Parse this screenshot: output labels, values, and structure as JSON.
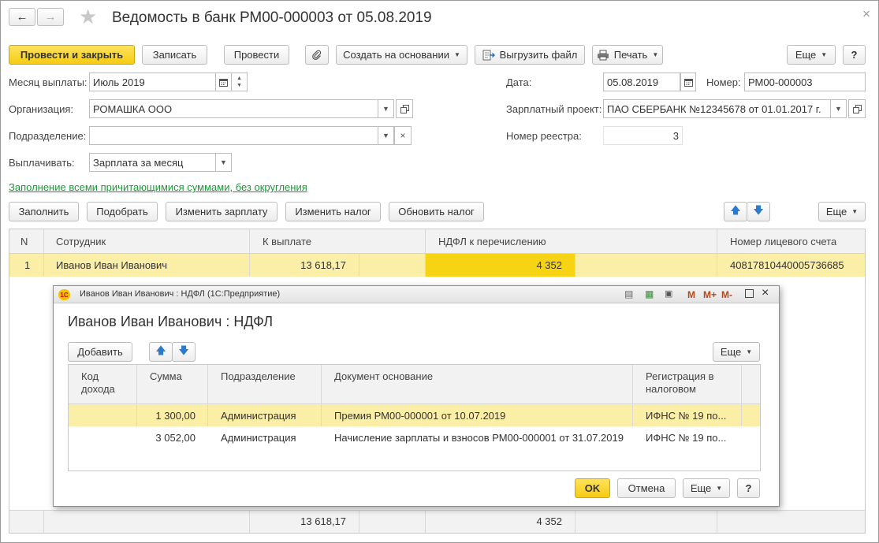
{
  "window": {
    "title": "Ведомость в банк РМ00-000003 от 05.08.2019",
    "close": "×"
  },
  "toolbar": {
    "post_close": "Провести и закрыть",
    "save": "Записать",
    "post": "Провести",
    "create_based": "Создать на основании",
    "export_file": "Выгрузить файл",
    "print": "Печать",
    "more": "Еще",
    "help": "?"
  },
  "form": {
    "month_label": "Месяц выплаты:",
    "month_value": "Июль 2019",
    "org_label": "Организация:",
    "org_value": "РОМАШКА ООО",
    "dept_label": "Подразделение:",
    "dept_value": "",
    "pay_label": "Выплачивать:",
    "pay_value": "Зарплата за месяц",
    "date_label": "Дата:",
    "date_value": "05.08.2019",
    "number_label": "Номер:",
    "number_value": "РМ00-000003",
    "project_label": "Зарплатный проект:",
    "project_value": "ПАО СБЕРБАНК №12345678 от 01.01.2017 г.",
    "registry_label": "Номер реестра:",
    "registry_value": "3",
    "fill_link": "Заполнение всеми причитающимися суммами, без округления"
  },
  "table_toolbar": {
    "fill": "Заполнить",
    "pick": "Подобрать",
    "change_salary": "Изменить зарплату",
    "change_tax": "Изменить налог",
    "update_tax": "Обновить налог",
    "more": "Еще"
  },
  "table": {
    "headers": {
      "n": "N",
      "employee": "Сотрудник",
      "to_pay": "К выплате",
      "ndfl": "НДФЛ к перечислению",
      "account": "Номер лицевого счета"
    },
    "rows": [
      {
        "n": "1",
        "employee": "Иванов Иван Иванович",
        "to_pay": "13 618,17",
        "ndfl": "4 352",
        "account": "40817810440005736685"
      }
    ],
    "footer": {
      "to_pay": "13 618,17",
      "ndfl": "4 352"
    }
  },
  "dialog": {
    "title": "Иванов Иван Иванович : НДФЛ  (1С:Предприятие)",
    "heading": "Иванов Иван Иванович : НДФЛ",
    "add": "Добавить",
    "more": "Еще",
    "headers": {
      "code": "Код дохода",
      "sum": "Сумма",
      "dept": "Подразделение",
      "doc": "Документ основание",
      "reg": "Регистрация в налоговом"
    },
    "rows": [
      {
        "code": "",
        "sum": "1 300,00",
        "dept": "Администрация",
        "doc": "Премия РМ00-000001 от 10.07.2019",
        "reg": "ИФНС № 19 по..."
      },
      {
        "code": "",
        "sum": "3 052,00",
        "dept": "Администрация",
        "doc": "Начисление зарплаты и взносов РМ00-000001 от 31.07.2019",
        "reg": "ИФНС № 19 по..."
      }
    ],
    "ok": "OK",
    "cancel": "Отмена",
    "help": "?",
    "title_buttons": {
      "m": "M",
      "mplus": "M+",
      "mminus": "M-"
    }
  }
}
